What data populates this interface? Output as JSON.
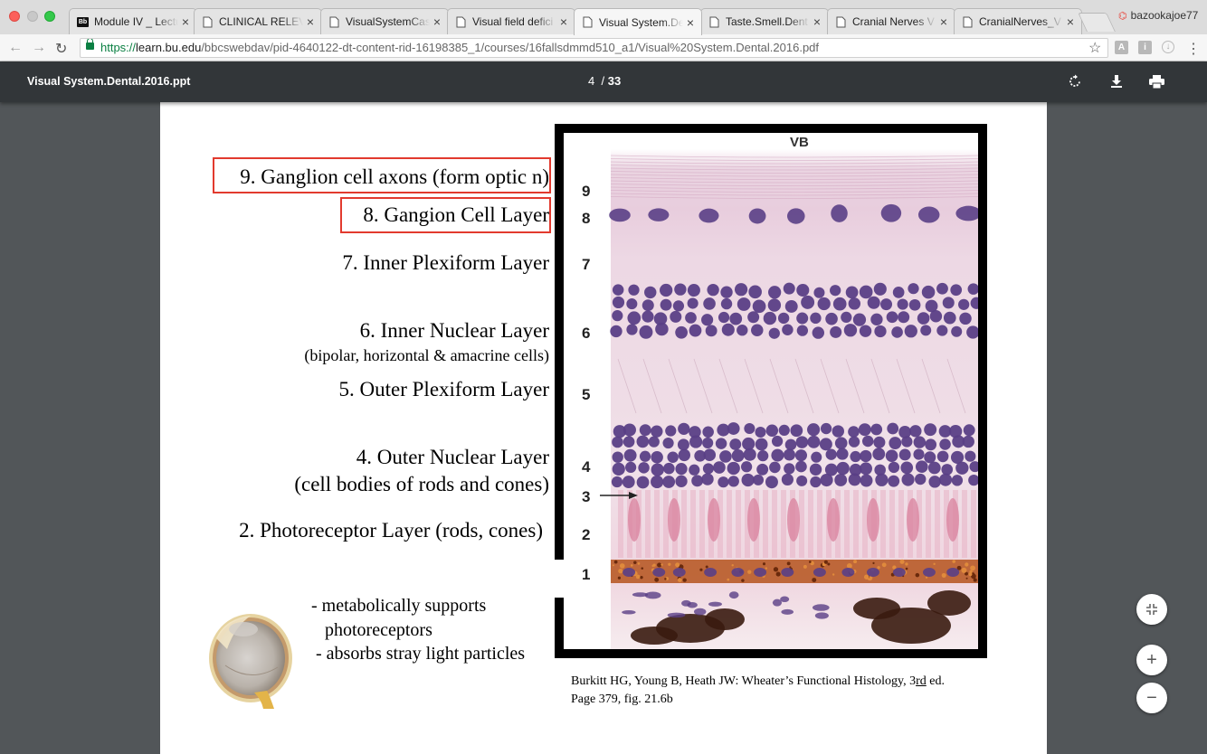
{
  "browser": {
    "tabs": [
      {
        "title": "Module IV _ Lectu",
        "icon": "blackboard-icon",
        "active": false
      },
      {
        "title": "CLINICAL RELEVA",
        "icon": "document-icon",
        "active": false
      },
      {
        "title": "VisualSystemCas",
        "icon": "document-icon",
        "active": false
      },
      {
        "title": "Visual field defici",
        "icon": "document-icon",
        "active": false
      },
      {
        "title": "Visual System.De",
        "icon": "document-icon",
        "active": true
      },
      {
        "title": "Taste.Smell.Dent",
        "icon": "document-icon",
        "active": false
      },
      {
        "title": "Cranial Nerves V",
        "icon": "document-icon",
        "active": false
      },
      {
        "title": "CranialNerves_V",
        "icon": "document-icon",
        "active": false
      }
    ],
    "profile_name": "bazookajoe77",
    "url": {
      "scheme": "https://",
      "host": "learn.bu.edu",
      "path": "/bbcswebdav/pid-4640122-dt-content-rid-16198385_1/courses/16fallsdmmd510_a1/Visual%20System.Dental.2016.pdf"
    }
  },
  "pdf_viewer": {
    "title": "Visual System.Dental.2016.ppt",
    "current_page": "4",
    "separator": "/",
    "total_pages": "33"
  },
  "slide": {
    "labels": {
      "l9": "9. Ganglion cell axons (form optic n)",
      "l8": "8. Gangion Cell Layer",
      "l7": "7. Inner Plexiform Layer",
      "l6": "6. Inner Nuclear Layer",
      "l6_sub": "(bipolar, horizontal & amacrine cells)",
      "l5": "5. Outer Plexiform Layer",
      "l4": "4. Outer Nuclear Layer",
      "l4_sub": "(cell bodies of rods and cones)",
      "l2": "2. Photoreceptor Layer (rods, cones)"
    },
    "bullets": {
      "b1": "- metabolically supports",
      "b1_cont": "photoreceptors",
      "b2": "- absorbs stray light particles"
    },
    "micrograph": {
      "header": "VB",
      "layer_numbers": [
        "9",
        "8",
        "7",
        "6",
        "5",
        "4",
        "3",
        "2",
        "1"
      ]
    },
    "caption": {
      "line1_pre": "Burkitt HG, Young B, Heath JW: Wheater’s Functional Histology, 3",
      "line1_sup": "rd",
      "line1_post": " ed.",
      "line2": "Page 379, fig. 21.6b"
    }
  },
  "colors": {
    "highlight_box": "#e23a2e",
    "nuclei": "#5a3f86",
    "tissue_pink": "#e6c6d8",
    "pigment": "#b5541c"
  }
}
